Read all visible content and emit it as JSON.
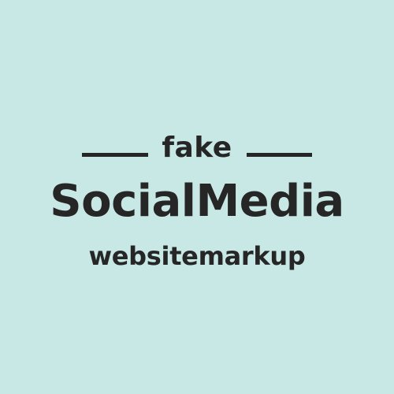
{
  "logo": {
    "top_text": "fake",
    "main_text": "SocialMedia",
    "sub_text": "websitemarkup"
  },
  "colors": {
    "background": "#c8e8e6",
    "text": "#262626"
  }
}
